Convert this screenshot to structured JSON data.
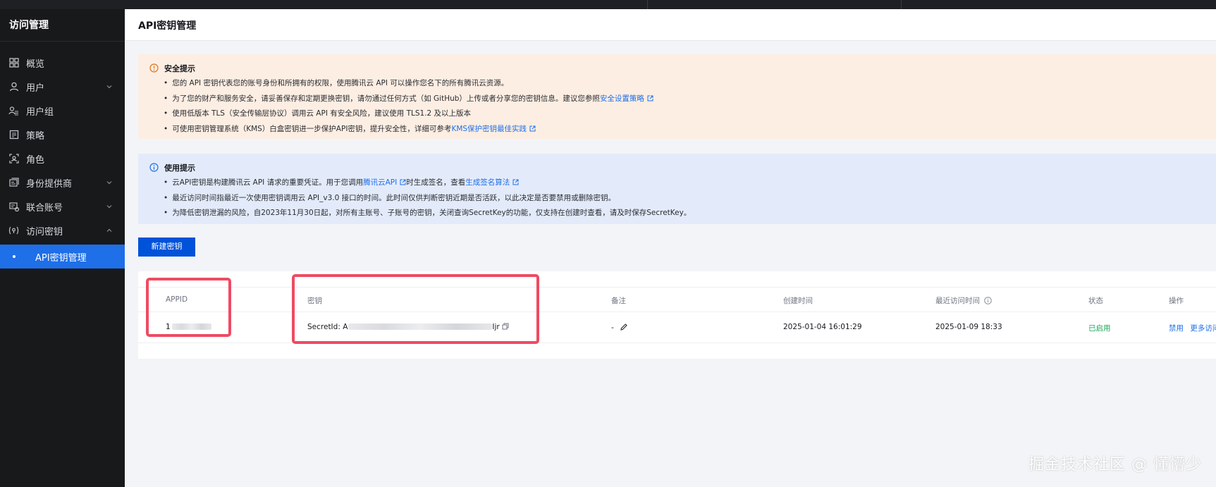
{
  "sidebar": {
    "title": "访问管理",
    "items": [
      {
        "label": "概览",
        "icon": "dashboard-icon"
      },
      {
        "label": "用户",
        "icon": "user-icon",
        "expandable": true
      },
      {
        "label": "用户组",
        "icon": "user-group-icon"
      },
      {
        "label": "策略",
        "icon": "policy-icon"
      },
      {
        "label": "角色",
        "icon": "role-icon"
      },
      {
        "label": "身份提供商",
        "icon": "identity-provider-icon",
        "expandable": true
      },
      {
        "label": "联合账号",
        "icon": "federated-account-icon",
        "expandable": true
      },
      {
        "label": "访问密钥",
        "icon": "access-key-icon",
        "expanded": true
      },
      {
        "label": "API密钥管理",
        "active": true
      }
    ]
  },
  "header": {
    "title": "API密钥管理"
  },
  "security_notice": {
    "title": "安全提示",
    "lines": [
      "您的 API 密钥代表您的账号身份和所拥有的权限，使用腾讯云 API 可以操作您名下的所有腾讯云资源。",
      "为了您的财产和服务安全，请妥善保存和定期更换密钥，请勿通过任何方式（如 GitHub）上传或者分享您的密钥信息。建议您参照",
      "使用低版本 TLS（安全传输层协议）调用云 API 有安全风险，建议使用 TLS1.2 及以上版本",
      "可使用密钥管理系统（KMS）白盒密钥进一步保护API密钥，提升安全性，详细可参考"
    ],
    "link1": "安全设置策略",
    "link2": "KMS保护密钥最佳实践"
  },
  "usage_notice": {
    "title": "使用提示",
    "line1_a": "云API密钥是构建腾讯云 API 请求的重要凭证。用于您调用",
    "line1_link1": "腾讯云API",
    "line1_b": "时生成签名，查看",
    "line1_link2": "生成签名算法",
    "line2": "最近访问时间指最近一次使用密钥调用云 API_v3.0 接口的时间。此时间仅供判断密钥近期是否活跃，以此决定是否要禁用或删除密钥。",
    "line3": "为降低密钥泄漏的风险，自2023年11月30日起，对所有主账号、子账号的密钥，关闭查询SecretKey的功能，仅支持在创建时查看，请及时保存SecretKey。"
  },
  "new_key_button": "新建密钥",
  "table": {
    "columns": [
      "APPID",
      "密钥",
      "备注",
      "创建时间",
      "最近访问时间",
      "状态",
      "操作"
    ],
    "row": {
      "appid_prefix": "1",
      "secret_label": "SecretId: A",
      "secret_suffix": "Ijr",
      "note": "-",
      "created": "2025-01-04 16:01:29",
      "last_access": "2025-01-09 18:33",
      "status": "已启用",
      "action_disable": "禁用",
      "action_more": "更多访问"
    }
  },
  "watermark": "掘金技术社区 @ 懂懵少",
  "colors": {
    "sidebar_bg": "#18191b",
    "active_item": "#1e6fe8",
    "primary_button": "#0052d9",
    "warning_bg": "#fdeee3",
    "info_bg": "#e3ebfb",
    "status_green": "#1aa758",
    "highlight_red": "#ee4b63"
  }
}
